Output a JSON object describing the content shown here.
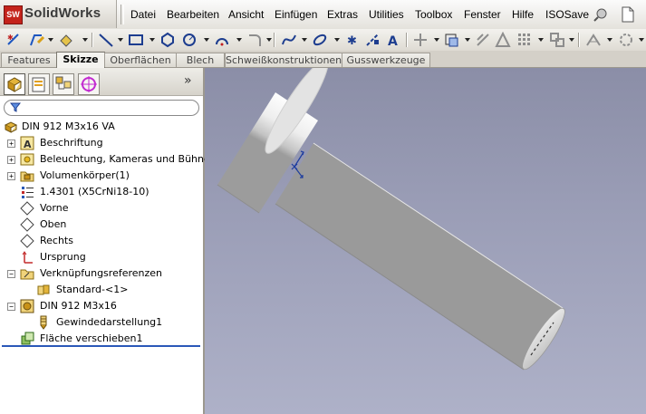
{
  "app": {
    "logo_badge": "SW",
    "name": "SolidWorks"
  },
  "menu": [
    "Datei",
    "Bearbeiten",
    "Ansicht",
    "Einfügen",
    "Extras",
    "Utilities",
    "Toolbox",
    "Fenster",
    "Hilfe",
    "ISOSave"
  ],
  "tabs": [
    {
      "label": "Features",
      "active": false
    },
    {
      "label": "Skizze",
      "active": true
    },
    {
      "label": "Oberflächen",
      "active": false
    },
    {
      "label": "Blech",
      "active": false
    },
    {
      "label": "Schweißkonstruktionen",
      "active": false
    },
    {
      "label": "Gusswerkzeuge",
      "active": false
    }
  ],
  "panel": {
    "expand_glyph": "»"
  },
  "tree": {
    "root": "DIN 912 M3x16 VA",
    "items": [
      {
        "label": "Beschriftung",
        "expander": "+"
      },
      {
        "label": "Beleuchtung, Kameras und Bühne",
        "expander": "+"
      },
      {
        "label": "Volumenkörper(1)",
        "expander": "+"
      },
      {
        "label": "1.4301 (X5CrNi18-10)",
        "expander": ""
      },
      {
        "label": "Vorne",
        "expander": ""
      },
      {
        "label": "Oben",
        "expander": ""
      },
      {
        "label": "Rechts",
        "expander": ""
      },
      {
        "label": "Ursprung",
        "expander": ""
      },
      {
        "label": "Verknüpfungsreferenzen",
        "expander": "−"
      },
      {
        "label": "Standard-<1>",
        "expander": ""
      },
      {
        "label": "DIN 912 M3x16",
        "expander": "−"
      },
      {
        "label": "Gewindedarstellung1",
        "expander": ""
      },
      {
        "label": "Fläche verschieben1",
        "expander": ""
      }
    ]
  },
  "colors": {
    "accent": "#2b58b8",
    "logo_red": "#c4231b",
    "viewport_top": "#8b8ea7",
    "viewport_bottom": "#aeb1c8"
  }
}
